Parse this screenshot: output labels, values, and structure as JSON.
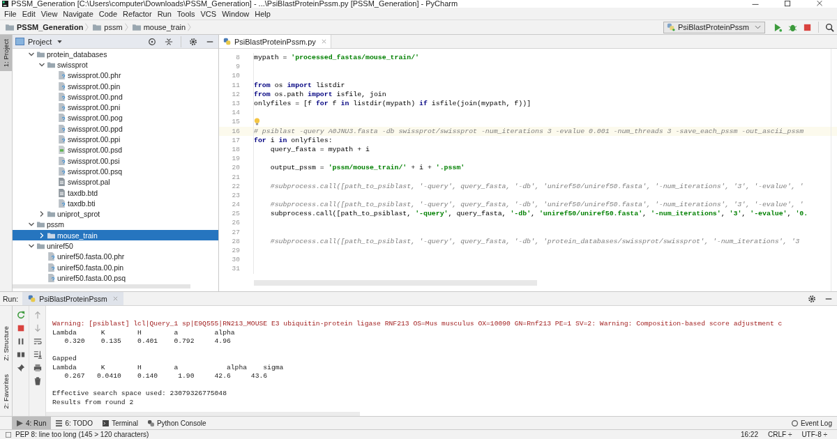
{
  "window": {
    "title": "PSSM_Generation [C:\\Users\\computer\\Downloads\\PSSM_Generation] - ...\\PsiBlastProteinPssm.py [PSSM_Generation] - PyCharm"
  },
  "menu": [
    "File",
    "Edit",
    "View",
    "Navigate",
    "Code",
    "Refactor",
    "Run",
    "Tools",
    "VCS",
    "Window",
    "Help"
  ],
  "breadcrumbs": [
    "PSSM_Generation",
    "pssm",
    "mouse_train"
  ],
  "run_config": {
    "label": "PsiBlastProteinPssm"
  },
  "side_tabs": [
    {
      "label": "1: Project",
      "selected": true
    },
    {
      "label": "Z: Structure",
      "selected": false
    },
    {
      "label": "2: Favorites",
      "selected": false
    }
  ],
  "project": {
    "title": "Project",
    "tree": [
      {
        "label": "protein_databases",
        "kind": "folder",
        "expanded": true,
        "selected": false,
        "children": [
          {
            "label": "swissprot",
            "kind": "folder",
            "expanded": true,
            "selected": false,
            "children": [
              {
                "label": "swissprot.00.phr",
                "kind": "unknown",
                "selected": false
              },
              {
                "label": "swissprot.00.pin",
                "kind": "unknown",
                "selected": false
              },
              {
                "label": "swissprot.00.pnd",
                "kind": "unknown",
                "selected": false
              },
              {
                "label": "swissprot.00.pni",
                "kind": "unknown",
                "selected": false
              },
              {
                "label": "swissprot.00.pog",
                "kind": "unknown",
                "selected": false
              },
              {
                "label": "swissprot.00.ppd",
                "kind": "unknown",
                "selected": false
              },
              {
                "label": "swissprot.00.ppi",
                "kind": "unknown",
                "selected": false
              },
              {
                "label": "swissprot.00.psd",
                "kind": "image",
                "selected": false
              },
              {
                "label": "swissprot.00.psi",
                "kind": "unknown",
                "selected": false
              },
              {
                "label": "swissprot.00.psq",
                "kind": "unknown",
                "selected": false
              },
              {
                "label": "swissprot.pal",
                "kind": "text",
                "selected": false
              },
              {
                "label": "taxdb.btd",
                "kind": "text",
                "selected": false
              },
              {
                "label": "taxdb.bti",
                "kind": "unknown",
                "selected": false
              }
            ]
          },
          {
            "label": "uniprot_sprot",
            "kind": "folder",
            "expanded": false,
            "selected": false
          }
        ]
      },
      {
        "label": "pssm",
        "kind": "folder",
        "expanded": true,
        "selected": false,
        "children": [
          {
            "label": "mouse_train",
            "kind": "folder",
            "expanded": false,
            "selected": true
          }
        ]
      },
      {
        "label": "uniref50",
        "kind": "folder",
        "expanded": true,
        "selected": false,
        "children": [
          {
            "label": "uniref50.fasta.00.phr",
            "kind": "unknown",
            "selected": false
          },
          {
            "label": "uniref50.fasta.00.pin",
            "kind": "unknown",
            "selected": false
          },
          {
            "label": "uniref50.fasta.00.psq",
            "kind": "unknown",
            "selected": false
          }
        ]
      }
    ]
  },
  "editor": {
    "tabs": [
      {
        "label": "PsiBlastProteinPssm.py",
        "selected": true
      }
    ],
    "lines": [
      {
        "num": "8",
        "highlighted": false,
        "tokens": [
          {
            "t": "mypath = ",
            "kind": "plain"
          },
          {
            "t": "'processed_fastas/mouse_train/'",
            "kind": "str"
          }
        ]
      },
      {
        "num": "9",
        "highlighted": false
      },
      {
        "num": "10",
        "highlighted": false
      },
      {
        "num": "11",
        "highlighted": false,
        "tokens": [
          {
            "t": "from",
            "kind": "kw"
          },
          {
            "t": " os ",
            "kind": "plain"
          },
          {
            "t": "import",
            "kind": "kw"
          },
          {
            "t": " listdir",
            "kind": "plain"
          }
        ]
      },
      {
        "num": "12",
        "highlighted": false,
        "tokens": [
          {
            "t": "from",
            "kind": "kw"
          },
          {
            "t": " os.path ",
            "kind": "plain"
          },
          {
            "t": "import",
            "kind": "kw"
          },
          {
            "t": " isfile, join",
            "kind": "plain"
          }
        ]
      },
      {
        "num": "13",
        "highlighted": false,
        "tokens": [
          {
            "t": "onlyfiles = [f ",
            "kind": "plain"
          },
          {
            "t": "for",
            "kind": "kw"
          },
          {
            "t": " f ",
            "kind": "plain"
          },
          {
            "t": "in",
            "kind": "kw"
          },
          {
            "t": " listdir(mypath) ",
            "kind": "plain"
          },
          {
            "t": "if",
            "kind": "kw"
          },
          {
            "t": " isfile(join(mypath, f))]",
            "kind": "plain"
          }
        ]
      },
      {
        "num": "14",
        "highlighted": false
      },
      {
        "num": "15",
        "highlighted": false,
        "bulb": true
      },
      {
        "num": "16",
        "highlighted": true,
        "tokens": [
          {
            "t": "# psiblast -query A0JNU3.fasta -db swissprot/swissprot -num_iterations 3 -evalue 0.001 -num_threads 3 -save_each_pssm -out_ascii_pssm",
            "kind": "comment"
          }
        ]
      },
      {
        "num": "17",
        "highlighted": false,
        "tokens": [
          {
            "t": "for",
            "kind": "kw"
          },
          {
            "t": " i ",
            "kind": "plain"
          },
          {
            "t": "in",
            "kind": "kw"
          },
          {
            "t": " onlyfiles:",
            "kind": "plain"
          }
        ]
      },
      {
        "num": "18",
        "highlighted": false,
        "tokens": [
          {
            "t": "    query_fasta = mypath + i",
            "kind": "plain"
          }
        ]
      },
      {
        "num": "19",
        "highlighted": false
      },
      {
        "num": "20",
        "highlighted": false,
        "tokens": [
          {
            "t": "    output_pssm = ",
            "kind": "plain"
          },
          {
            "t": "'pssm/mouse_train/'",
            "kind": "str"
          },
          {
            "t": " + i + ",
            "kind": "plain"
          },
          {
            "t": "'.pssm'",
            "kind": "str"
          }
        ]
      },
      {
        "num": "21",
        "highlighted": false
      },
      {
        "num": "22",
        "highlighted": false,
        "tokens": [
          {
            "t": "    #subprocess.call([path_to_psiblast, '-query', query_fasta, '-db', 'uniref50/uniref50.fasta', '-num_iterations', '3', '-evalue', '",
            "kind": "comment"
          }
        ]
      },
      {
        "num": "23",
        "highlighted": false
      },
      {
        "num": "24",
        "highlighted": false,
        "tokens": [
          {
            "t": "    #subprocess.call([path_to_psiblast, '-query', query_fasta, '-db', 'uniref50/uniref50.fasta', '-num_iterations', '3', '-evalue', '",
            "kind": "comment"
          }
        ]
      },
      {
        "num": "25",
        "highlighted": false,
        "tokens": [
          {
            "t": "    subprocess.call([path_to_psiblast, ",
            "kind": "plain"
          },
          {
            "t": "'-query'",
            "kind": "str"
          },
          {
            "t": ", query_fasta, ",
            "kind": "plain"
          },
          {
            "t": "'-db'",
            "kind": "str"
          },
          {
            "t": ", ",
            "kind": "plain"
          },
          {
            "t": "'uniref50/uniref50.fasta'",
            "kind": "str"
          },
          {
            "t": ", ",
            "kind": "plain"
          },
          {
            "t": "'-num_iterations'",
            "kind": "str"
          },
          {
            "t": ", ",
            "kind": "plain"
          },
          {
            "t": "'3'",
            "kind": "str"
          },
          {
            "t": ", ",
            "kind": "plain"
          },
          {
            "t": "'-evalue'",
            "kind": "str"
          },
          {
            "t": ", ",
            "kind": "plain"
          },
          {
            "t": "'0.",
            "kind": "str"
          }
        ]
      },
      {
        "num": "26",
        "highlighted": false
      },
      {
        "num": "27",
        "highlighted": false
      },
      {
        "num": "28",
        "highlighted": false,
        "tokens": [
          {
            "t": "    #subprocess.call([path_to_psiblast, '-query', query_fasta, '-db', 'protein_databases/swissprot/swissprot', '-num_iterations', '3",
            "kind": "comment"
          }
        ]
      },
      {
        "num": "29",
        "highlighted": false
      },
      {
        "num": "30",
        "highlighted": false
      },
      {
        "num": "31",
        "highlighted": false
      }
    ]
  },
  "run": {
    "label": "Run:",
    "tab": "PsiBlastProteinPssm",
    "blocks": [
      [
        {
          "t": "Warning: [psiblast] lcl|Query_1 sp|E9Q555|RN213_MOUSE E3 ubiquitin-protein ligase RNF213 OS=Mus musculus OX=10090 GN=Rnf213 PE=1 SV=2: Warning: Composition-based score adjustment c",
          "kind": "warning"
        },
        {
          "t": "Lambda      K        H        a         alpha",
          "kind": "plain"
        },
        {
          "t": "   0.320    0.135    0.401    0.792     4.96",
          "kind": "plain"
        }
      ],
      [
        {
          "t": "Gapped",
          "kind": "plain"
        },
        {
          "t": "Lambda      K        H        a            alpha    sigma",
          "kind": "plain"
        },
        {
          "t": "   0.267   0.0410    0.140     1.90     42.6     43.6",
          "kind": "plain"
        }
      ],
      [
        {
          "t": "Effective search space used: 23079326775048",
          "kind": "plain"
        },
        {
          "t": "Results from round 2",
          "kind": "plain"
        }
      ]
    ]
  },
  "tool_tabs": [
    {
      "label": "4: Run",
      "kind": "run",
      "selected": true
    },
    {
      "label": "6: TODO",
      "kind": "todo",
      "selected": false
    },
    {
      "label": "Terminal",
      "kind": "terminal",
      "selected": false
    },
    {
      "label": "Python Console",
      "kind": "python",
      "selected": false
    }
  ],
  "event_log": "Event Log",
  "status": {
    "message": "PEP 8: line too long (145 > 120 characters)",
    "items": [
      "16:22",
      "CRLF ÷",
      "UTF-8 ÷"
    ]
  }
}
